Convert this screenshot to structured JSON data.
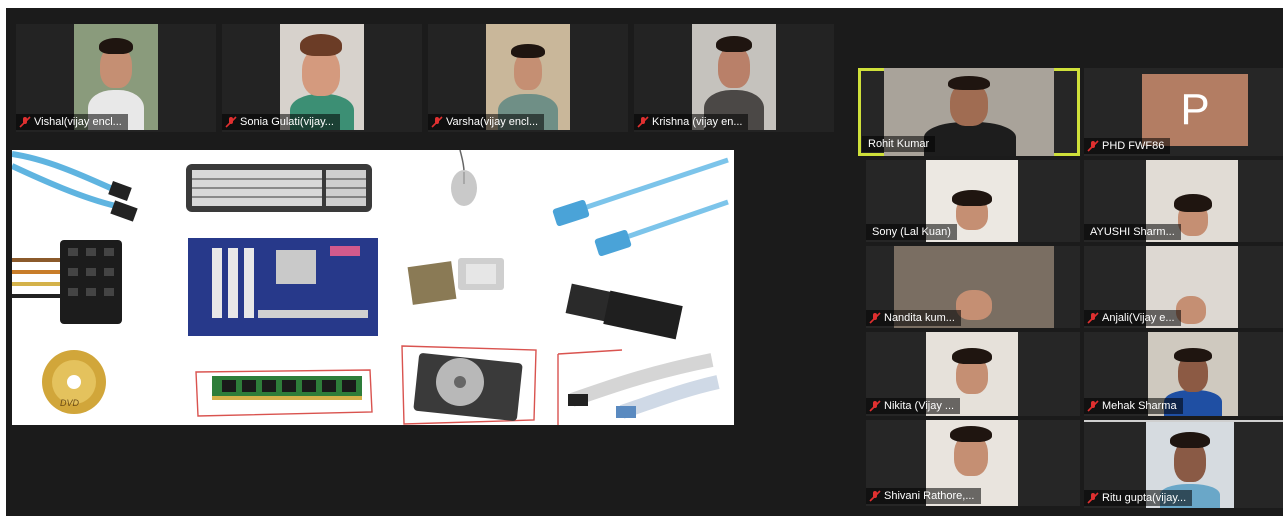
{
  "top_participants": [
    {
      "name": "Vishal(vijay encl..."
    },
    {
      "name": "Sonia Gulati(vijay..."
    },
    {
      "name": "Varsha(vijay encl..."
    },
    {
      "name": "Krishna (vijay en..."
    }
  ],
  "right_participants": [
    {
      "name": "Rohit Kumar"
    },
    {
      "name": "PHD FWF86",
      "avatar_letter": "P"
    },
    {
      "name": "Sony (Lal Kuan)"
    },
    {
      "name": "AYUSHI  Sharm..."
    },
    {
      "name": "Nandita kum..."
    },
    {
      "name": "Anjali(Vijay e..."
    },
    {
      "name": "Nikita (Vijay ..."
    },
    {
      "name": "Mehak Sharma"
    },
    {
      "name": "Shivani Rathore,..."
    },
    {
      "name": "Ritu gupta(vijay..."
    }
  ],
  "shared_screen": {
    "items": [
      "sata-cable-icon",
      "keyboard-icon",
      "mouse-icon",
      "ethernet-cable-icon",
      "power-connector-icon",
      "motherboard-icon",
      "cpu-icon",
      "ssd-icon",
      "dvd-icon",
      "ram-icon",
      "hard-disk-icon",
      "ribbon-cable-icon"
    ],
    "dvd_label": "DVD"
  },
  "colors": {
    "active_speaker": "#cfe03a",
    "mute_red": "#e03030",
    "background": "#1b1b1b"
  }
}
